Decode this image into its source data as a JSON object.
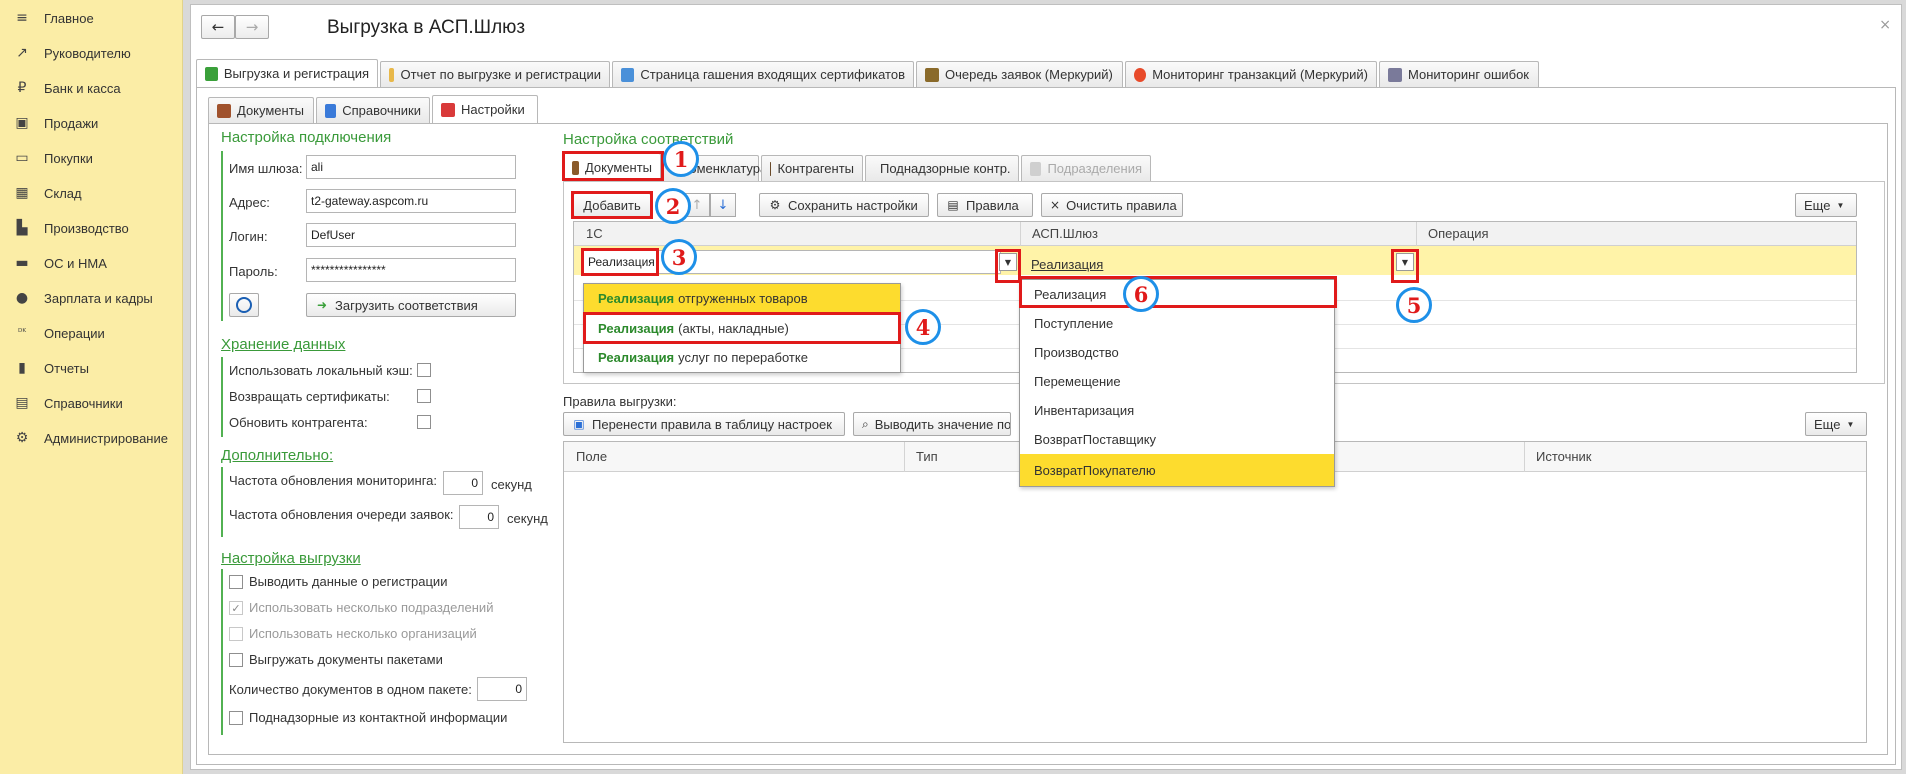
{
  "sidebar": {
    "items": [
      {
        "label": "Главное",
        "icon": "menu-icon",
        "glyph": "≡"
      },
      {
        "label": "Руководителю",
        "icon": "trend-icon",
        "glyph": "↗"
      },
      {
        "label": "Банк и касса",
        "icon": "coin-icon",
        "glyph": "₽"
      },
      {
        "label": "Продажи",
        "icon": "bag-icon",
        "glyph": "▣"
      },
      {
        "label": "Покупки",
        "icon": "cart-icon",
        "glyph": "▭"
      },
      {
        "label": "Склад",
        "icon": "warehouse-icon",
        "glyph": "▦"
      },
      {
        "label": "Производство",
        "icon": "factory-icon",
        "glyph": "▙"
      },
      {
        "label": "ОС и НМА",
        "icon": "truck-icon",
        "glyph": "▬"
      },
      {
        "label": "Зарплата и кадры",
        "icon": "person-icon",
        "glyph": "●"
      },
      {
        "label": "Операции",
        "icon": "operations-icon",
        "glyph": "ᴰᴷ"
      },
      {
        "label": "Отчеты",
        "icon": "bar-chart-icon",
        "glyph": "▮"
      },
      {
        "label": "Справочники",
        "icon": "books-icon",
        "glyph": "▤"
      },
      {
        "label": "Администрирование",
        "icon": "gear-icon",
        "glyph": "⚙"
      }
    ]
  },
  "window": {
    "back": "←",
    "forward": "→",
    "title": "Выгрузка в АСП.Шлюз",
    "close": "×"
  },
  "main_tabs": [
    {
      "label": "Выгрузка и регистрация",
      "color": "#3aa03a"
    },
    {
      "label": "Отчет по выгрузке и регистрации",
      "color": "#e8b84a"
    },
    {
      "label": "Страница гашения входящих сертификатов",
      "color": "#4a90d9"
    },
    {
      "label": "Очередь заявок (Меркурий)",
      "color": "#8a6a2a"
    },
    {
      "label": "Мониторинг транзакций (Меркурий)",
      "color": "#e84a2a"
    },
    {
      "label": "Мониторинг ошибок",
      "color": "#7a7a9a"
    }
  ],
  "sub_tabs": [
    {
      "label": "Документы",
      "color": "#a0522d"
    },
    {
      "label": "Справочники",
      "color": "#3a7ad9"
    },
    {
      "label": "Настройки",
      "color": "#d93a3a"
    }
  ],
  "connection": {
    "title": "Настройка подключения",
    "gateway_label": "Имя шлюза:",
    "gateway_value": "ali",
    "address_label": "Адрес:",
    "address_value": "t2-gateway.aspcom.ru",
    "login_label": "Логин:",
    "login_value": "DefUser",
    "password_label": "Пароль:",
    "password_value": "****************",
    "load_button": "Загрузить соответствия"
  },
  "storage": {
    "title": "Хранение данных",
    "local_cache": "Использовать локальный кэш:",
    "return_certs": "Возвращать сертификаты:",
    "update_counterparty": "Обновить контрагента:"
  },
  "additional": {
    "title": "Дополнительно:",
    "monitoring_freq": "Частота обновления мониторинга:",
    "monitoring_value": "0",
    "queue_freq": "Частота обновления очереди заявок:",
    "queue_value": "0",
    "unit": "секунд"
  },
  "export_settings": {
    "title": "Настройка выгрузки",
    "show_registration": "Выводить данные о регистрации",
    "multi_divisions": "Использовать несколько подразделений",
    "multi_orgs": "Использовать несколько организаций",
    "batch_docs": "Выгружать документы пакетами",
    "batch_count_label": "Количество документов в одном пакете:",
    "batch_count_value": "0",
    "supervised_contacts": "Поднадзорные из контактной информации"
  },
  "mapping": {
    "title": "Настройка соответствий",
    "tabs": [
      "Документы",
      "Номенклатура",
      "Контрагенты",
      "Поднадзорные контр.",
      "Подразделения"
    ],
    "toolbar": {
      "add": "Добавить",
      "save": "Сохранить настройки",
      "rules": "Правила",
      "clear": "Очистить правила",
      "more": "Еще"
    },
    "columns": [
      "1С",
      "АСП.Шлюз",
      "Операция"
    ],
    "row_1c": "Реализация",
    "row_asp": "Реализация"
  },
  "dropdown_1c": {
    "items": [
      {
        "bold": "Реализация",
        "rest": "отгруженных товаров"
      },
      {
        "bold": "Реализация",
        "rest": "(акты, накладные)"
      },
      {
        "bold": "Реализация",
        "rest": "услуг по переработке"
      }
    ]
  },
  "dropdown_asp": {
    "items": [
      "Реализация",
      "Поступление",
      "Производство",
      "Перемещение",
      "Инвентаризация",
      "ВозвратПоставщику",
      "ВозвратПокупателю"
    ]
  },
  "export_rules": {
    "title": "Правила выгрузки:",
    "move_button": "Перенести правила в таблицу настроек",
    "show_value_button": "Выводить значение по",
    "more": "Еще",
    "columns": [
      "Поле",
      "Тип",
      "Источник"
    ]
  },
  "annotations": [
    "1",
    "2",
    "3",
    "4",
    "5",
    "6"
  ],
  "colors": {
    "sidebar_bg": "#fbeda6",
    "green": "#3a9a3a",
    "highlight": "#fddc2e",
    "selected_row": "#fff3a8",
    "annotation_red": "#e01a1a",
    "annotation_blue": "#1e90e8"
  }
}
